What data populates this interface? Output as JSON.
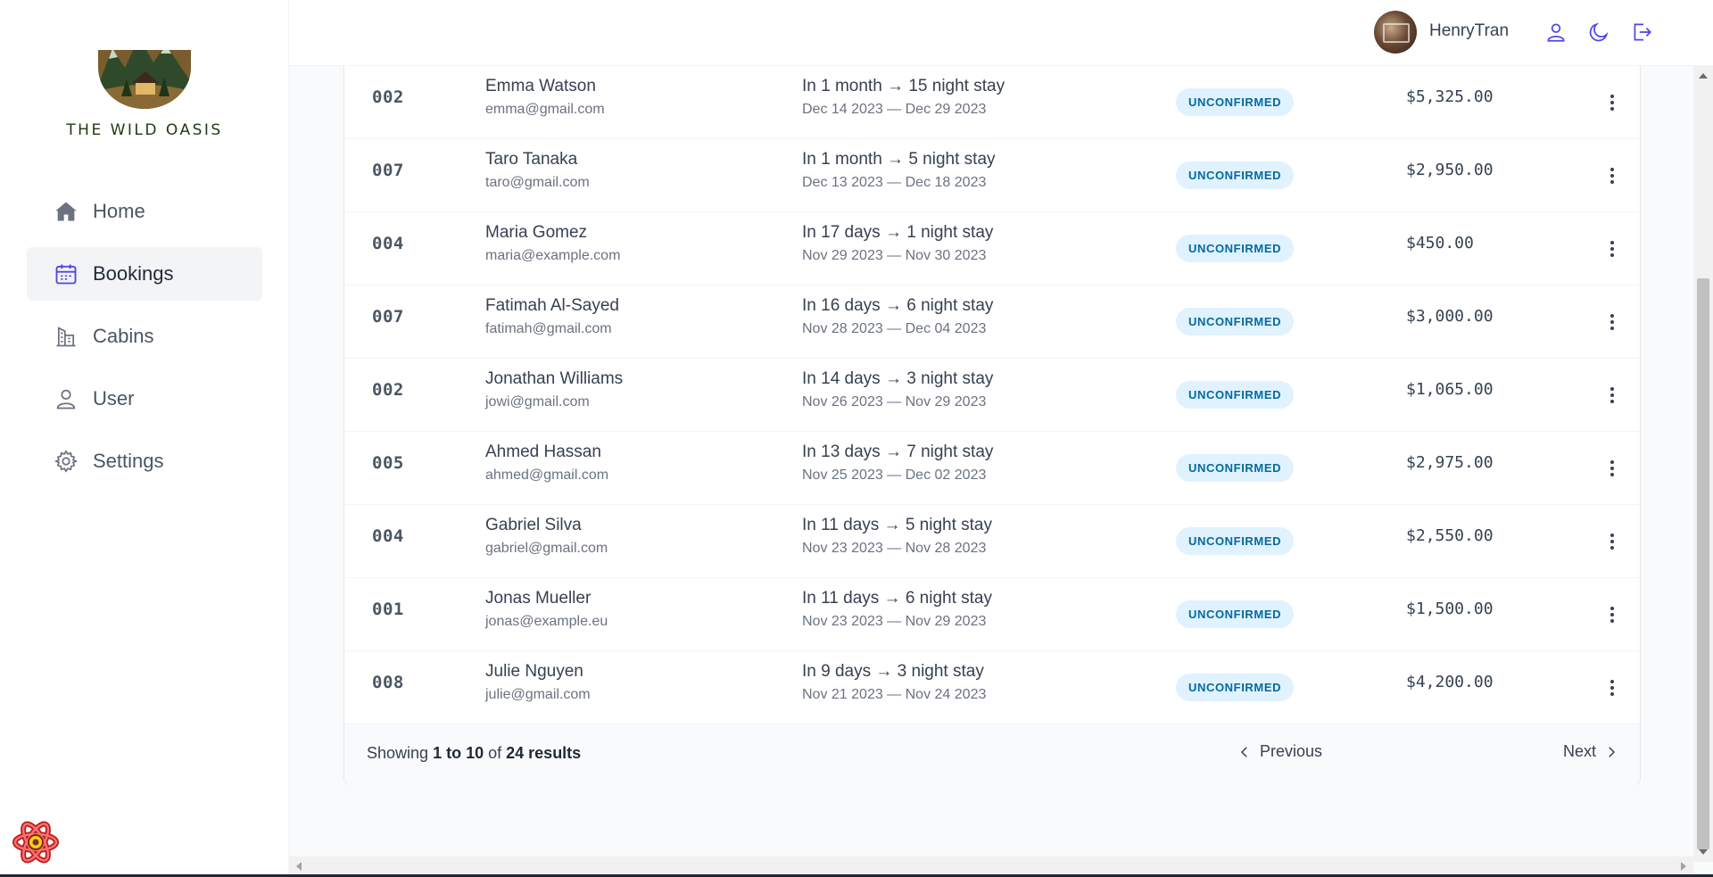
{
  "app": {
    "logo_text": "THE WILD OASIS"
  },
  "sidebar": {
    "items": [
      {
        "label": "Home",
        "icon": "home-icon",
        "active": false
      },
      {
        "label": "Bookings",
        "icon": "calendar-icon",
        "active": true
      },
      {
        "label": "Cabins",
        "icon": "building-icon",
        "active": false
      },
      {
        "label": "User",
        "icon": "user-icon",
        "active": false
      },
      {
        "label": "Settings",
        "icon": "gear-icon",
        "active": false
      }
    ]
  },
  "header": {
    "username": "HenryTran",
    "icons": [
      "user-icon",
      "moon-icon",
      "logout-icon"
    ],
    "accent": "#4f46e5"
  },
  "bookings": [
    {
      "cabin": "002",
      "guest": "Emma Watson",
      "email": "emma@gmail.com",
      "stay": "In 1 month → 15 night stay",
      "dates": "Dec 14 2023 — Dec 29 2023",
      "status": "UNCONFIRMED",
      "amount": "$5,325.00"
    },
    {
      "cabin": "007",
      "guest": "Taro Tanaka",
      "email": "taro@gmail.com",
      "stay": "In 1 month → 5 night stay",
      "dates": "Dec 13 2023 — Dec 18 2023",
      "status": "UNCONFIRMED",
      "amount": "$2,950.00"
    },
    {
      "cabin": "004",
      "guest": "Maria Gomez",
      "email": "maria@example.com",
      "stay": "In 17 days → 1 night stay",
      "dates": "Nov 29 2023 — Nov 30 2023",
      "status": "UNCONFIRMED",
      "amount": "$450.00"
    },
    {
      "cabin": "007",
      "guest": "Fatimah Al-Sayed",
      "email": "fatimah@gmail.com",
      "stay": "In 16 days → 6 night stay",
      "dates": "Nov 28 2023 — Dec 04 2023",
      "status": "UNCONFIRMED",
      "amount": "$3,000.00"
    },
    {
      "cabin": "002",
      "guest": "Jonathan Williams",
      "email": "jowi@gmail.com",
      "stay": "In 14 days → 3 night stay",
      "dates": "Nov 26 2023 — Nov 29 2023",
      "status": "UNCONFIRMED",
      "amount": "$1,065.00"
    },
    {
      "cabin": "005",
      "guest": "Ahmed Hassan",
      "email": "ahmed@gmail.com",
      "stay": "In 13 days → 7 night stay",
      "dates": "Nov 25 2023 — Dec 02 2023",
      "status": "UNCONFIRMED",
      "amount": "$2,975.00"
    },
    {
      "cabin": "004",
      "guest": "Gabriel Silva",
      "email": "gabriel@gmail.com",
      "stay": "In 11 days → 5 night stay",
      "dates": "Nov 23 2023 — Nov 28 2023",
      "status": "UNCONFIRMED",
      "amount": "$2,550.00"
    },
    {
      "cabin": "001",
      "guest": "Jonas Mueller",
      "email": "jonas@example.eu",
      "stay": "In 11 days → 6 night stay",
      "dates": "Nov 23 2023 — Nov 29 2023",
      "status": "UNCONFIRMED",
      "amount": "$1,500.00"
    },
    {
      "cabin": "008",
      "guest": "Julie Nguyen",
      "email": "julie@gmail.com",
      "stay": "In 9 days → 3 night stay",
      "dates": "Nov 21 2023 — Nov 24 2023",
      "status": "UNCONFIRMED",
      "amount": "$4,200.00"
    }
  ],
  "pagination": {
    "showing_prefix": "Showing",
    "range": "1 to 10",
    "of": "of",
    "total": "24 results",
    "previous_label": "Previous",
    "next_label": "Next"
  },
  "colors": {
    "status_bg": "#e0f2fe",
    "status_text": "#0369a1"
  }
}
